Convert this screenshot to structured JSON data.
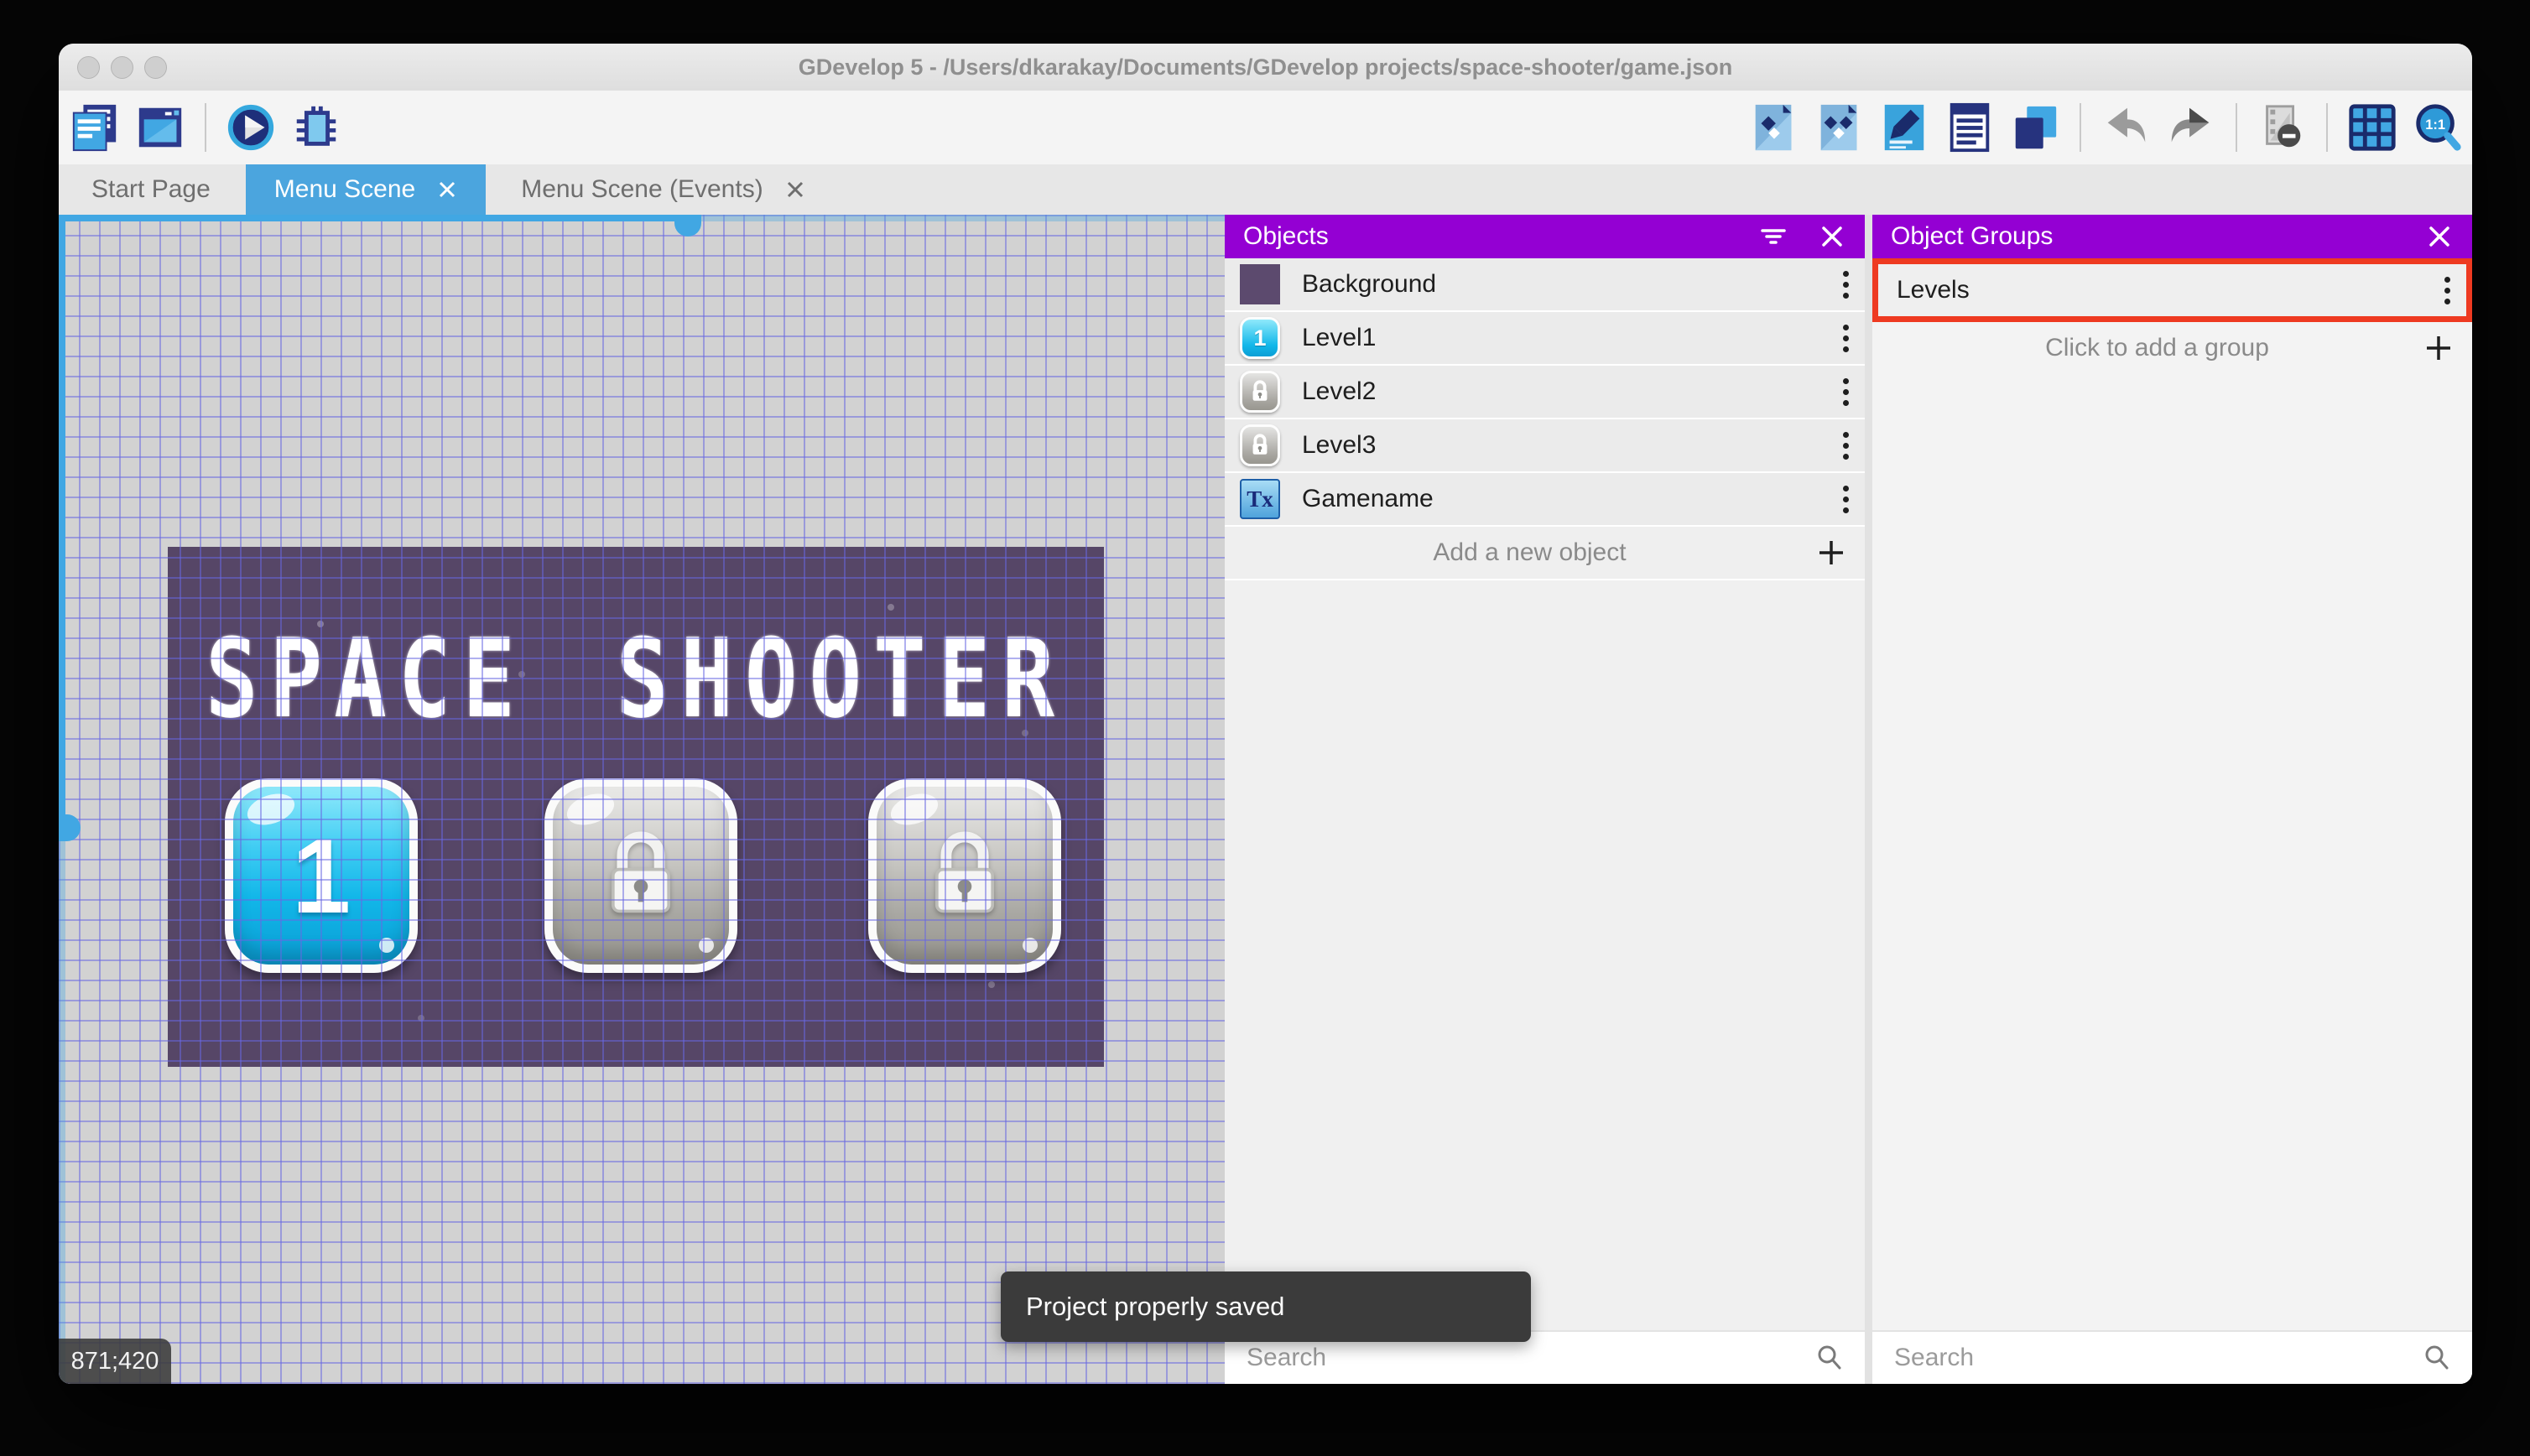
{
  "window": {
    "title": "GDevelop 5 - /Users/dkarakay/Documents/GDevelop projects/space-shooter/game.json"
  },
  "tabs": [
    {
      "label": "Start Page",
      "active": false,
      "closable": false
    },
    {
      "label": "Menu Scene",
      "active": true,
      "closable": true
    },
    {
      "label": "Menu Scene (Events)",
      "active": false,
      "closable": true
    }
  ],
  "toolbar": {
    "left_icons": [
      "project-manager",
      "scene-editor-window",
      "play",
      "debug"
    ],
    "right_icons": [
      "objects-editor",
      "object-groups-editor",
      "properties",
      "instances-list",
      "layers",
      "undo",
      "redo",
      "render-mask",
      "grid",
      "zoom-1-1"
    ],
    "zoom_label": "1:1"
  },
  "canvas": {
    "coordinates": "871;420"
  },
  "scene": {
    "title": "SPACE SHOOTER",
    "level1_label": "1",
    "buttons": [
      {
        "name": "Level1",
        "state": "unlocked",
        "label": "1"
      },
      {
        "name": "Level2",
        "state": "locked"
      },
      {
        "name": "Level3",
        "state": "locked"
      }
    ]
  },
  "objects_panel": {
    "title": "Objects",
    "items": [
      {
        "name": "Background",
        "thumb": "purple-square"
      },
      {
        "name": "Level1",
        "thumb": "blue-button-1"
      },
      {
        "name": "Level2",
        "thumb": "gray-lock-button"
      },
      {
        "name": "Level3",
        "thumb": "gray-lock-button"
      },
      {
        "name": "Gamename",
        "thumb": "text-object"
      }
    ],
    "add_label": "Add a new object",
    "search_placeholder": "Search"
  },
  "groups_panel": {
    "title": "Object Groups",
    "items": [
      {
        "name": "Levels",
        "highlighted": true
      }
    ],
    "add_label": "Click to add a group",
    "search_placeholder": "Search"
  },
  "toast": {
    "message": "Project properly saved"
  },
  "icons": {
    "text_object_glyph": "Tx"
  },
  "colors": {
    "panel_header": "#9400D3",
    "active_tab": "#4BA5DE",
    "highlight_red": "#EE3A21",
    "scene_background": "#564667",
    "canvas_background": "#D2D2D2",
    "grid_line": "#6868E2",
    "scrollbar_blue": "#41A7E3",
    "toast_background": "#3B3B3B"
  }
}
